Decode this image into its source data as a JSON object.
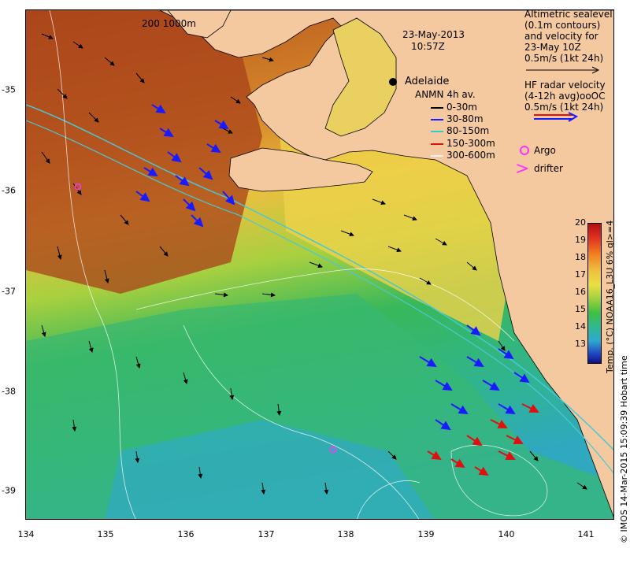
{
  "map": {
    "datetime_line1": "23-May-2013",
    "datetime_line2": "10:57Z",
    "scale_label": "200  1000m",
    "place_label": "Adelaide",
    "x_ticks": [
      "134",
      "135",
      "136",
      "137",
      "138",
      "139",
      "140",
      "141"
    ],
    "y_ticks": [
      "-35",
      "-36",
      "-37",
      "-38",
      "-39"
    ]
  },
  "legend": {
    "altimetry_lines": [
      "Altimetric sealevel",
      "(0.1m contours)",
      "and velocity for",
      "23-May 10Z",
      "0.5m/s (1kt 24h)"
    ],
    "hf_lines": [
      "HF radar velocity",
      "(4-12h avg)",
      "0.5m/s (1kt 24h)"
    ],
    "hf_site_code": "ooOC",
    "anmn_title": "ANMN 4h av.",
    "anmn_items": [
      {
        "label": "0-30m",
        "color": "#000000"
      },
      {
        "label": "30-80m",
        "color": "#1a1aff"
      },
      {
        "label": "80-150m",
        "color": "#33cccc"
      },
      {
        "label": "150-300m",
        "color": "#e01010"
      },
      {
        "label": "300-600m",
        "color": "#f0f0f0"
      }
    ],
    "argo_label": "Argo",
    "drifter_label": "drifter"
  },
  "colorbar": {
    "ticks": [
      "20",
      "19",
      "18",
      "17",
      "16",
      "15",
      "14",
      "13"
    ],
    "title": "Temp. (°C) NOAA16_L3U 6% ql>=4"
  },
  "credit": "© IMOS 14-Mar-2015 15:09:39 Hobart time",
  "colors": {
    "land": "#f5c9a0",
    "warm": "#c6501c",
    "mid": "#f0d64a",
    "cool": "#3bbf5a",
    "cold": "#33b6c6",
    "argo": "#ff33ff"
  }
}
